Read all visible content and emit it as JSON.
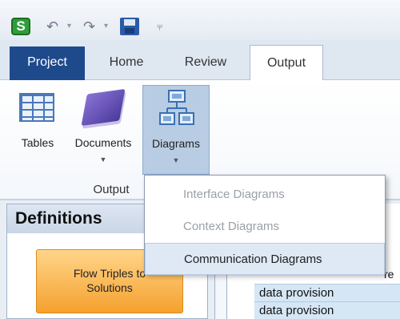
{
  "quick_access": {
    "app_icon_letter": "S",
    "undo_icon": "undo-icon",
    "redo_icon": "redo-icon",
    "save_icon": "save-icon",
    "customize_icon": "customize-qat-icon"
  },
  "tabs": [
    {
      "label": "Project"
    },
    {
      "label": "Home"
    },
    {
      "label": "Review"
    },
    {
      "label": "Output"
    }
  ],
  "ribbon": {
    "buttons": [
      {
        "label": "Tables",
        "icon": "table-icon"
      },
      {
        "label": "Documents",
        "icon": "documents-icon"
      },
      {
        "label": "Diagrams",
        "icon": "diagrams-icon"
      }
    ],
    "group_label": "Output"
  },
  "dropdown": {
    "items": [
      {
        "label": "Interface Diagrams",
        "enabled": false
      },
      {
        "label": "Context Diagrams",
        "enabled": false
      },
      {
        "label": "Communication Diagrams",
        "enabled": true
      }
    ]
  },
  "definitions": {
    "title": "Definitions",
    "flow_button_line1": "Flow Triples to",
    "flow_button_line2": "Solutions"
  },
  "right_panel": {
    "partial_text": "re",
    "rows": [
      "data provision",
      "data provision"
    ]
  },
  "colors": {
    "project_tab": "#1e4a8c",
    "selected_button": "#b8cde4",
    "flow_button": "#f5a12e",
    "cell_bg": "#d5e6f5"
  }
}
